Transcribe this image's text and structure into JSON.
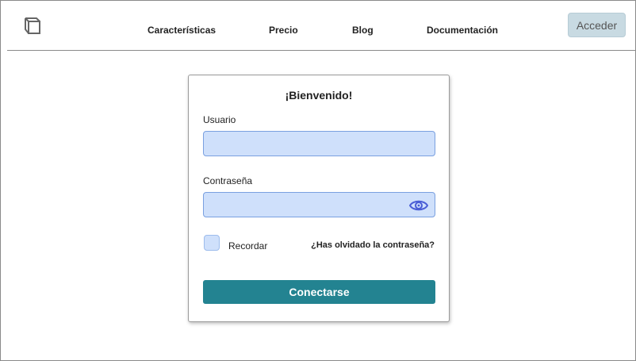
{
  "header": {
    "logo_icon": "cube-icon",
    "nav": [
      {
        "label": "Características"
      },
      {
        "label": "Precio"
      },
      {
        "label": "Blog"
      },
      {
        "label": "Documentación"
      }
    ],
    "login_button": "Acceder"
  },
  "login_card": {
    "title": "¡Bienvenido!",
    "username_label": "Usuario",
    "username_value": "",
    "password_label": "Contraseña",
    "password_value": "",
    "show_password_icon": "eye-icon",
    "remember_label": "Recordar",
    "remember_checked": false,
    "forgot_link": "¿Has olvidado la contraseña?",
    "submit_label": "Conectarse"
  },
  "colors": {
    "accent": "#238391",
    "field_bg": "#cfe0fb",
    "field_border": "#7aa0e0",
    "header_button_bg": "#c8dae2"
  }
}
